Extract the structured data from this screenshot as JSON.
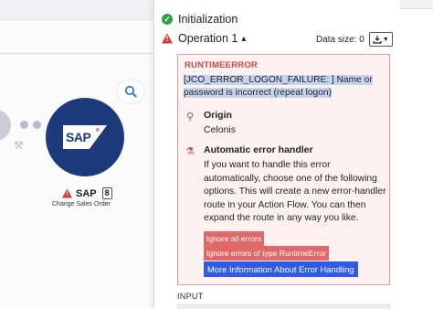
{
  "canvas": {
    "node": {
      "logo_text": "SAP",
      "logo_mark": "®",
      "title": "SAP",
      "badge": "8",
      "subtitle": "Change Sales Order",
      "icon": "sap-logo",
      "brand_color": "#1d3a7d"
    }
  },
  "panel": {
    "status": {
      "label": "Initialization",
      "icon": "check-circle-icon",
      "color": "#2e9e4a"
    },
    "operation": {
      "label": "Operation 1",
      "chevron": "▴",
      "icon": "warning-icon",
      "color": "#d33a3a"
    },
    "data_size": {
      "label": "Data size: 0",
      "download_icon": "download-icon"
    },
    "error": {
      "type": "RUNTIMEERROR",
      "message": "[JCO_ERROR_LOGON_FAILURE: ] Name or password is incorrect (repeat logon)",
      "origin_title": "Origin",
      "origin_value": "Celonis",
      "handler_title": "Automatic error handler",
      "handler_description": "If you want to handle this error automatically, choose one of the following options. This will create a new error-handler route in your Action Flow. You can then expand the route in any way you like.",
      "buttons": {
        "ignore_all": "Ignore all errors",
        "ignore_type": "Ignore errors of type RuntimeError",
        "more_info": "More Information About Error Handling"
      }
    },
    "input_label": "INPUT"
  },
  "colors": {
    "error_red": "#cf4646",
    "button_red": "#e06868",
    "button_blue": "#2f5bea",
    "error_bg": "#fdf1f1"
  }
}
